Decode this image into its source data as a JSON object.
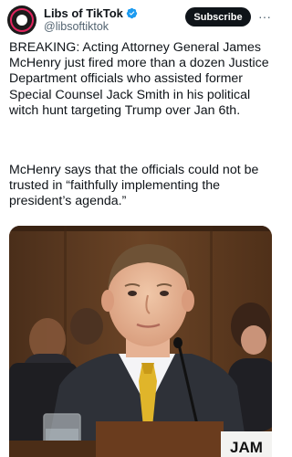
{
  "author": {
    "display_name": "Libs of TikTok",
    "handle": "@libsoftiktok",
    "verified": true,
    "avatar_icon": "libs-of-tiktok-logo-icon"
  },
  "actions": {
    "subscribe_label": "Subscribe",
    "more_label": "···"
  },
  "tweet": {
    "paragraph_1": "BREAKING: Acting Attorney General James McHenry just fired more than a dozen Justice Department officials who assisted former Special Counsel Jack Smith in his political witch hunt targeting Trump over Jan 6th.",
    "paragraph_2": "McHenry says that the officials could not be trusted in “faithfully implementing the president’s agenda.”"
  },
  "media": {
    "nameplate_text": "JAM"
  },
  "colors": {
    "accent": "#1d9bf0",
    "text": "#0f1419",
    "secondary": "#536471"
  }
}
